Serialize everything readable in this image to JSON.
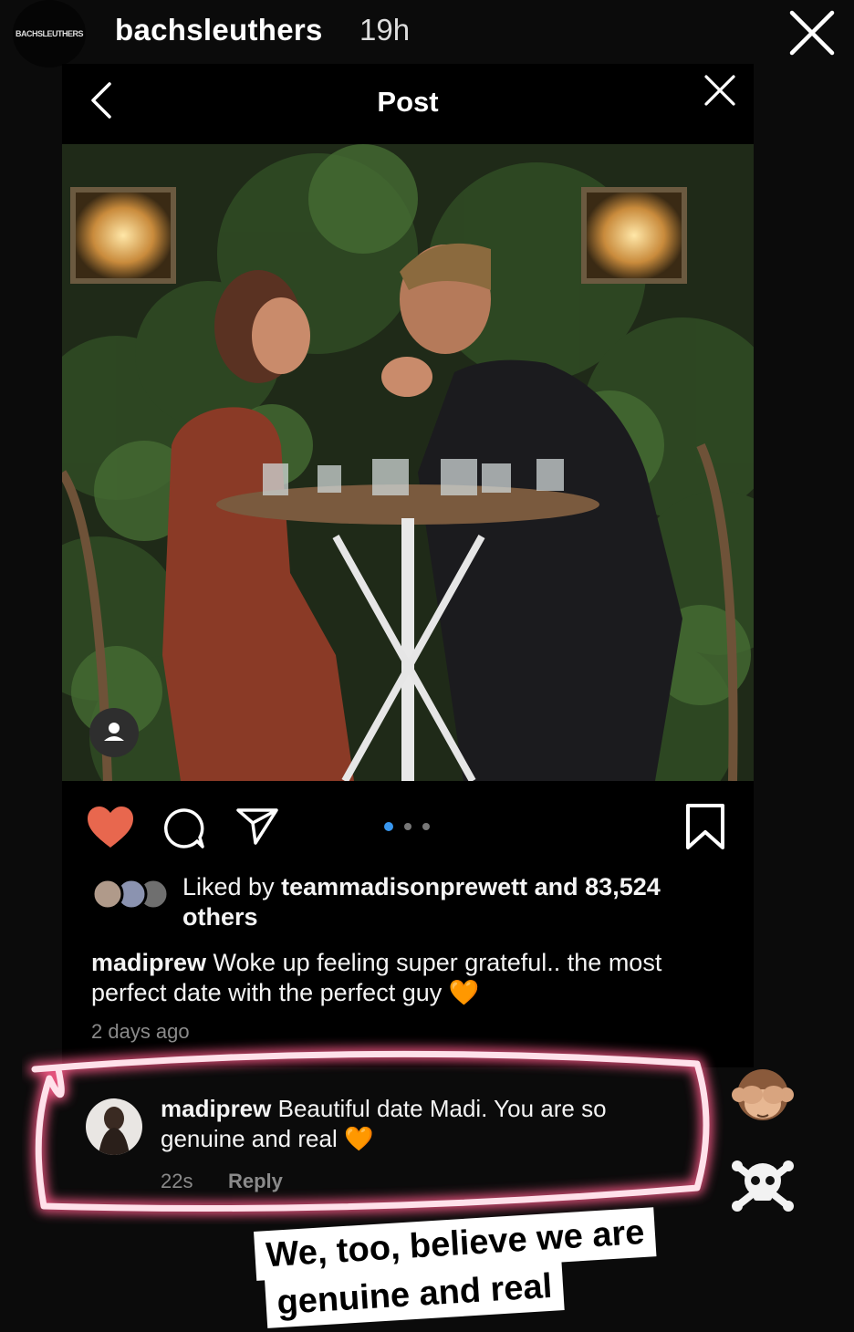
{
  "story": {
    "avatar_text": "BACHSLEUTHERS",
    "username": "bachsleuthers",
    "time": "19h"
  },
  "post_header": {
    "title": "Post"
  },
  "post": {
    "carousel_pages": 3,
    "carousel_active": 1,
    "likes_prefix": "Liked by ",
    "liked_by_user": "teammadisonprewett",
    "likes_suffix": " and 83,524 others",
    "caption_user": "madiprew",
    "caption_text": " Woke up feeling super grateful.. the most perfect date with the perfect guy 🧡",
    "posted_ago": "2 days ago"
  },
  "comment": {
    "user": "madiprew",
    "text": " Beautiful date Madi. You are so genuine and real 🧡",
    "time": "22s",
    "reply_label": "Reply"
  },
  "stickers": {
    "emoji_1": "see-no-evil-monkey",
    "emoji_2": "skull-and-crossbones",
    "line_1": "We, too, believe we are",
    "line_2": "genuine and real"
  },
  "colors": {
    "like_heart": "#e8674e",
    "carousel_active": "#3897f0",
    "highlight_glow": "#ffb3c7"
  }
}
